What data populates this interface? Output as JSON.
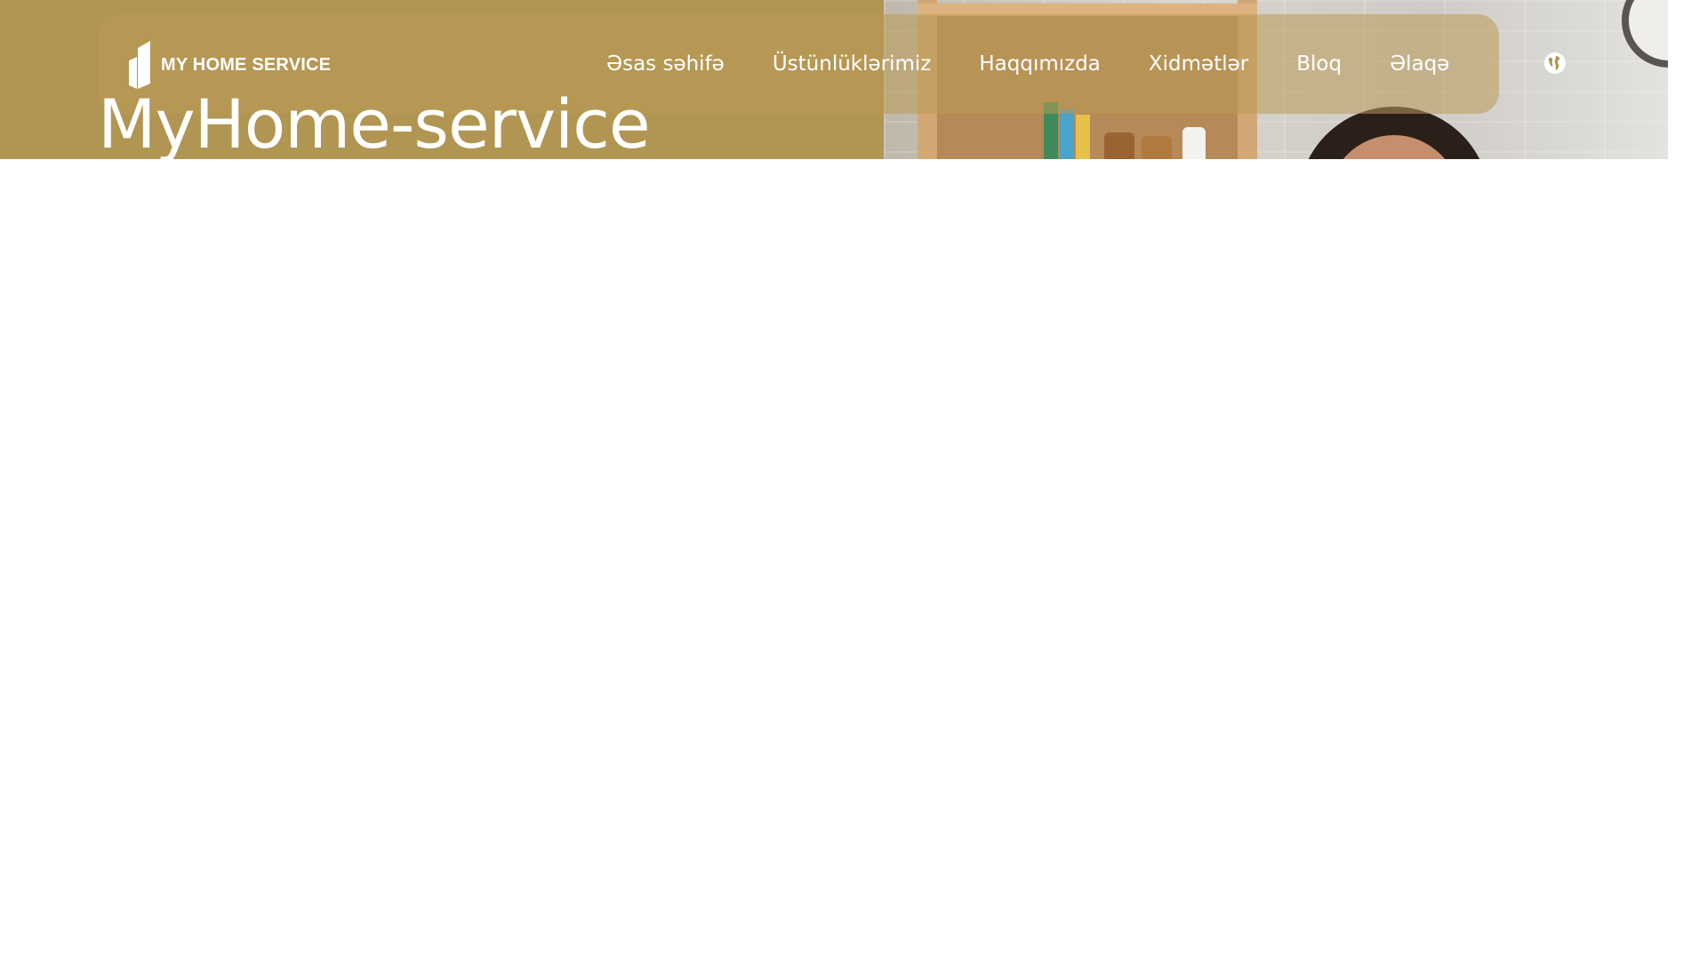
{
  "brand": {
    "name": "MY HOME SERVICE",
    "logo_icon": "building-logo-icon"
  },
  "nav": {
    "items": [
      {
        "label": "Əsas səhifə"
      },
      {
        "label": "Üstünlüklərimiz"
      },
      {
        "label": "Haqqımızda"
      },
      {
        "label": "Xidmətlər"
      },
      {
        "label": "Bloq"
      },
      {
        "label": "Əlaqə"
      }
    ],
    "language_icon": "globe-icon"
  },
  "hero": {
    "title": "MyHome-service"
  },
  "colors": {
    "accent": "#b19552",
    "nav_text": "#ffffff",
    "background": "#ffffff"
  }
}
